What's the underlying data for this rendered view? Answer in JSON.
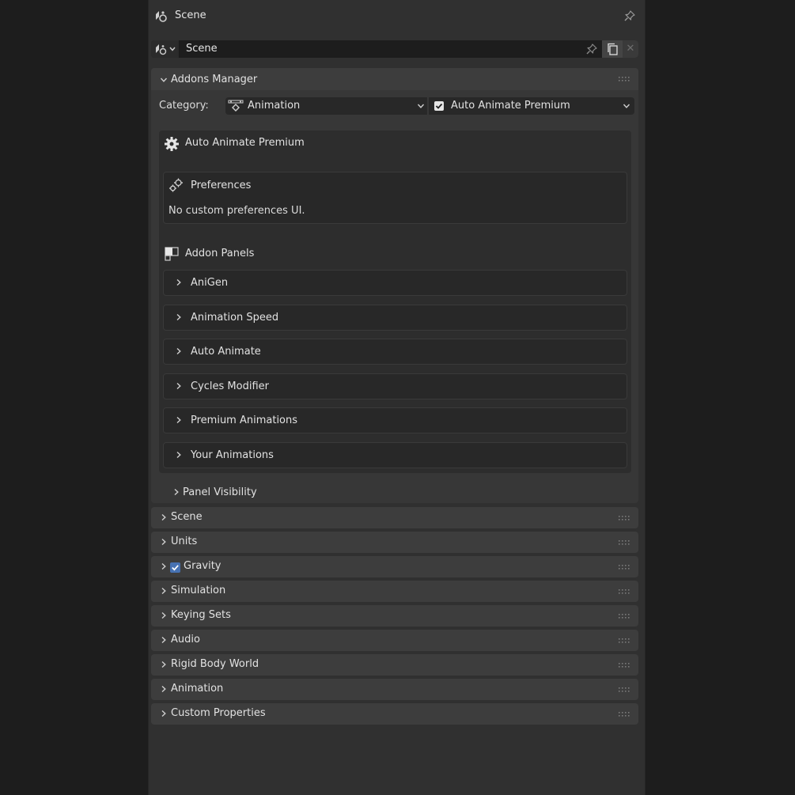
{
  "header": {
    "title": "Scene"
  },
  "id_block": {
    "name": "Scene"
  },
  "addons_manager": {
    "title": "Addons Manager",
    "category_label": "Category:",
    "category_value": "Animation",
    "addon_value": "Auto Animate Premium",
    "addon_enabled": true,
    "addon_title": "Auto Animate Premium",
    "preferences_title": "Preferences",
    "preferences_message": "No custom preferences UI.",
    "addon_panels_title": "Addon Panels",
    "addon_panels": [
      {
        "label": "AniGen"
      },
      {
        "label": "Animation Speed"
      },
      {
        "label": "Auto Animate"
      },
      {
        "label": "Cycles Modifier"
      },
      {
        "label": "Premium Animations"
      },
      {
        "label": "Your Animations"
      }
    ],
    "panel_visibility_label": "Panel Visibility"
  },
  "panels": [
    {
      "label": "Scene"
    },
    {
      "label": "Units"
    },
    {
      "label": "Gravity",
      "checked": true
    },
    {
      "label": "Simulation"
    },
    {
      "label": "Keying Sets"
    },
    {
      "label": "Audio"
    },
    {
      "label": "Rigid Body World"
    },
    {
      "label": "Animation"
    },
    {
      "label": "Custom Properties"
    }
  ],
  "colors": {
    "accent": "#4772b3",
    "panel_bg": "#3d3d3d",
    "editor_bg": "#303030",
    "field_bg": "#282828"
  },
  "icons": {
    "context": "scene-icon",
    "pin": "pin-icon",
    "copy": "duplicate-icon",
    "addon": "gear-icon",
    "preferences": "preferences-gear-icon",
    "addon_panels": "window-icon"
  }
}
